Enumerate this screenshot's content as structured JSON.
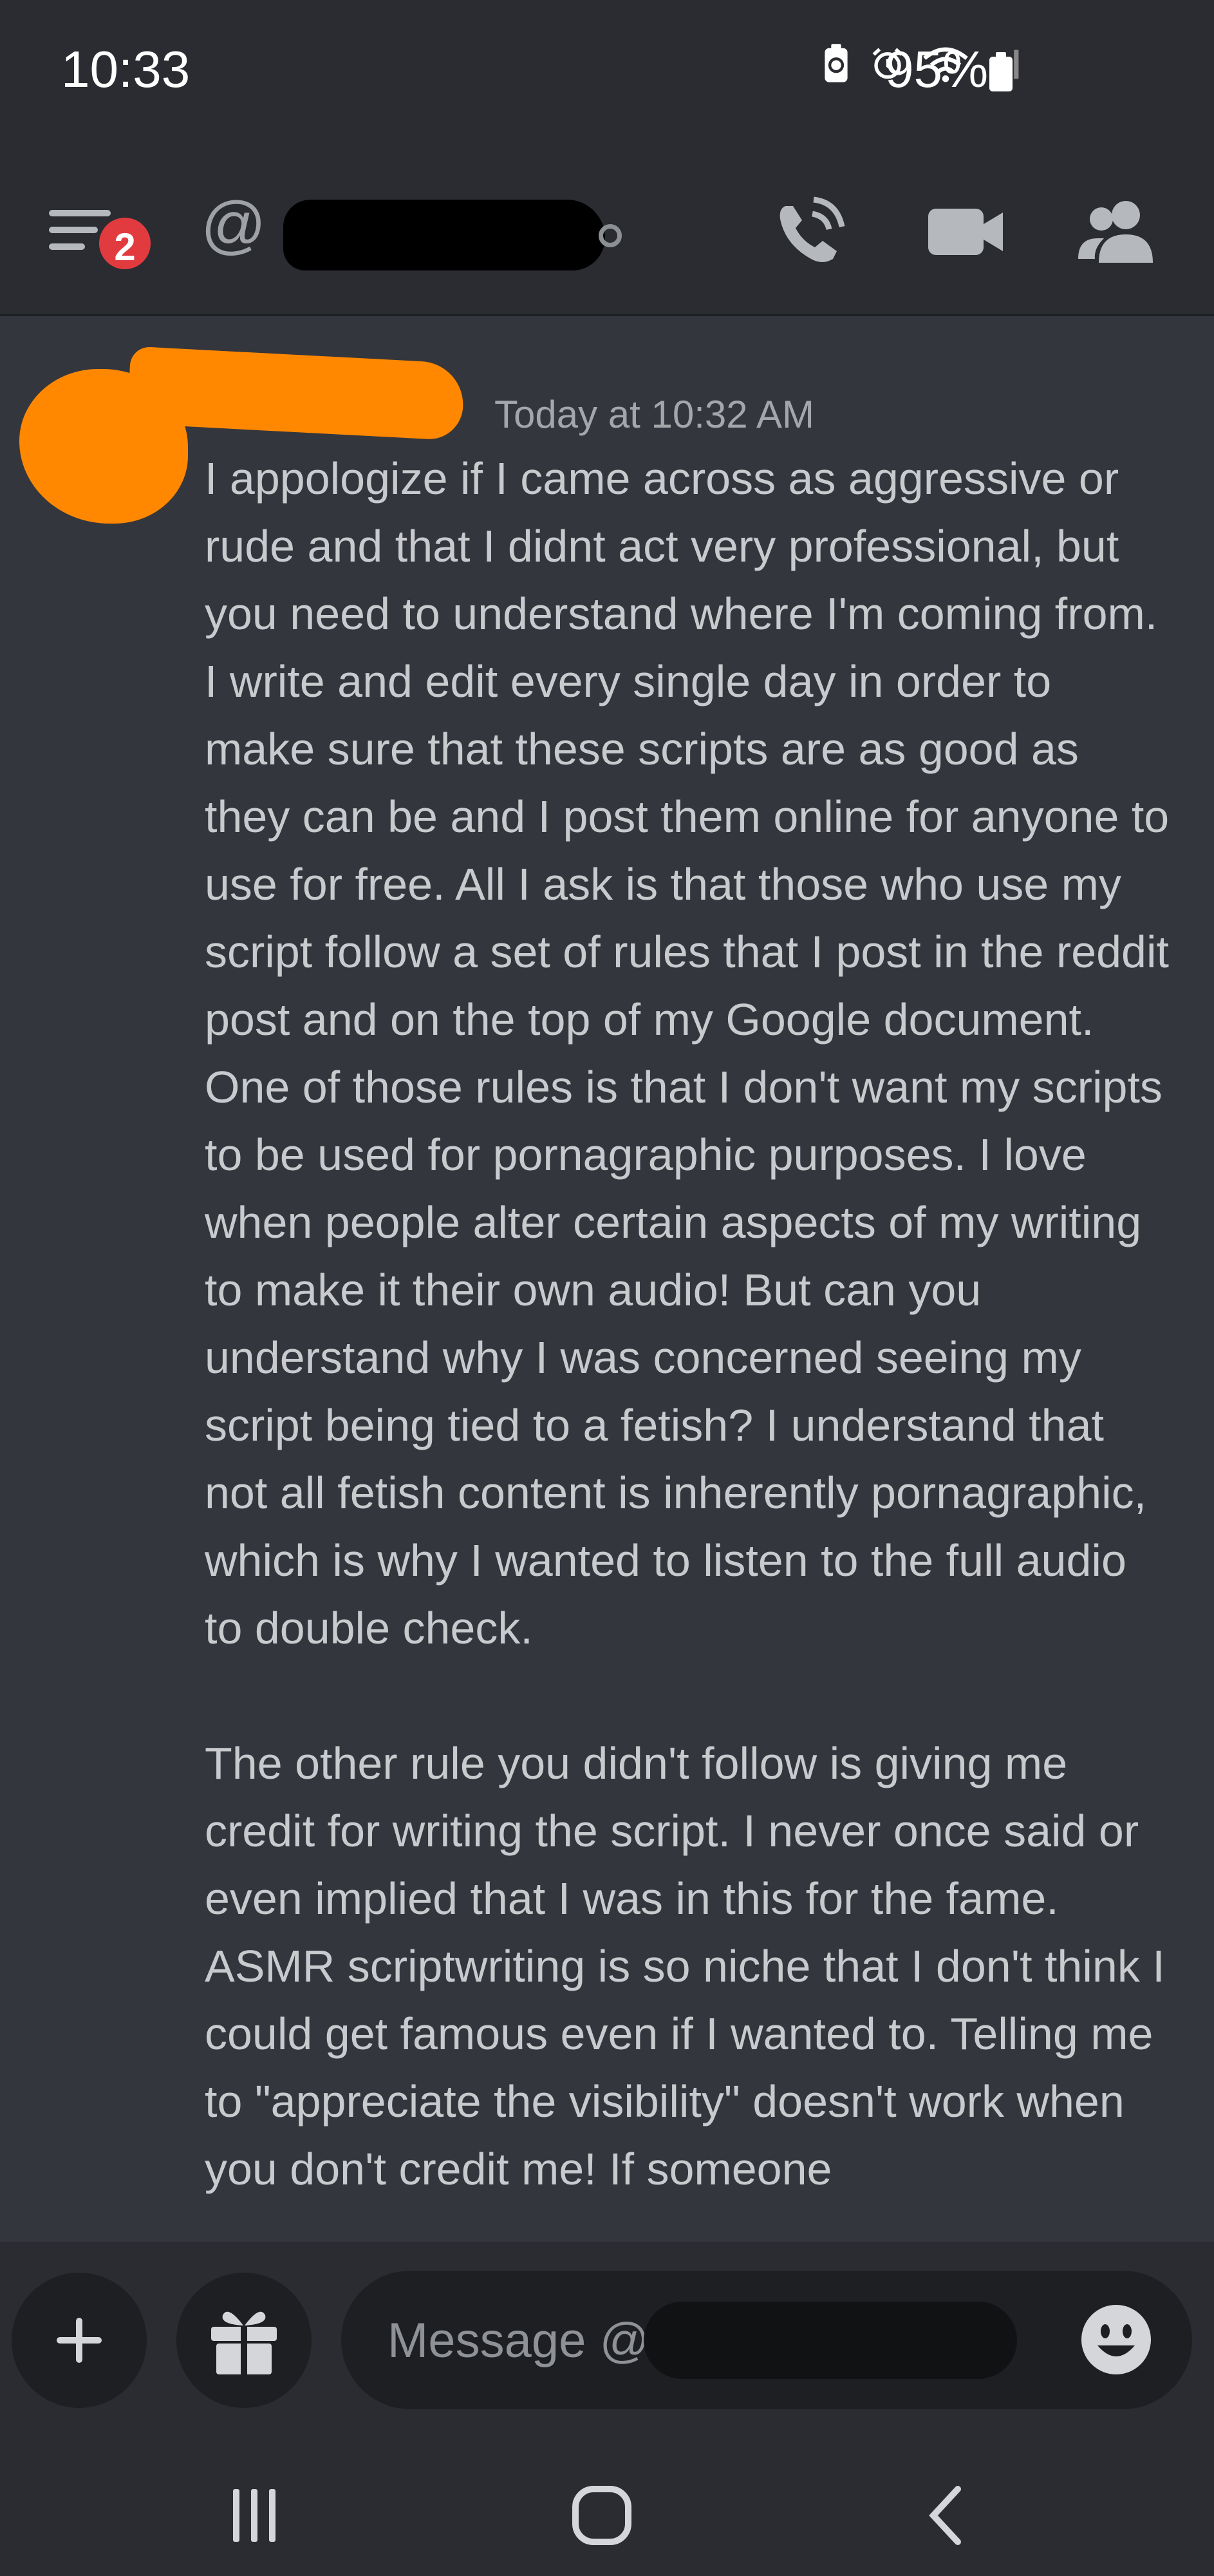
{
  "status_bar": {
    "time": "10:33",
    "battery_percent": "95%",
    "icons": [
      "battery-saver-icon",
      "alarm-icon",
      "wifi-icon",
      "signal-icon"
    ]
  },
  "header": {
    "notification_count": "2",
    "at_symbol": "@",
    "icons": [
      "menu-icon",
      "phone-call-icon",
      "video-camera-icon",
      "members-icon"
    ]
  },
  "message": {
    "timestamp": "Today at 10:32 AM",
    "paragraphs": [
      "I appologize if I came across as aggressive or rude and that I didnt act very professional, but you need to understand where I'm coming from. I write and edit every single day in order to make sure that these scripts are as good as they can be and I post them online for anyone to use for free. All I ask is that those who use my script follow a set of rules that I post in the reddit post and on the top of my Google document. One of those rules is that I don't want my scripts to be used for pornagraphic purposes. I love when people alter certain aspects of my writing to make it their own audio! But can you understand why I was concerned seeing my script being tied to a fetish? I understand that not all fetish content is inherently pornagraphic, which is why I wanted to listen to the full audio to double check.",
      "The other rule you didn't follow is giving me credit for writing the script. I never once said or even implied that I was in this for the fame. ASMR scriptwriting is so niche that I don't think I could get famous even if I wanted to. Telling me to \"appreciate the visibility\" doesn't work when you don't credit me! If someone"
    ]
  },
  "composer": {
    "placeholder": "Message @"
  },
  "colors": {
    "background": "#34363d",
    "chrome": "#2a2c31",
    "badge": "#e23b3f",
    "redaction_orange": "#ff8800"
  }
}
